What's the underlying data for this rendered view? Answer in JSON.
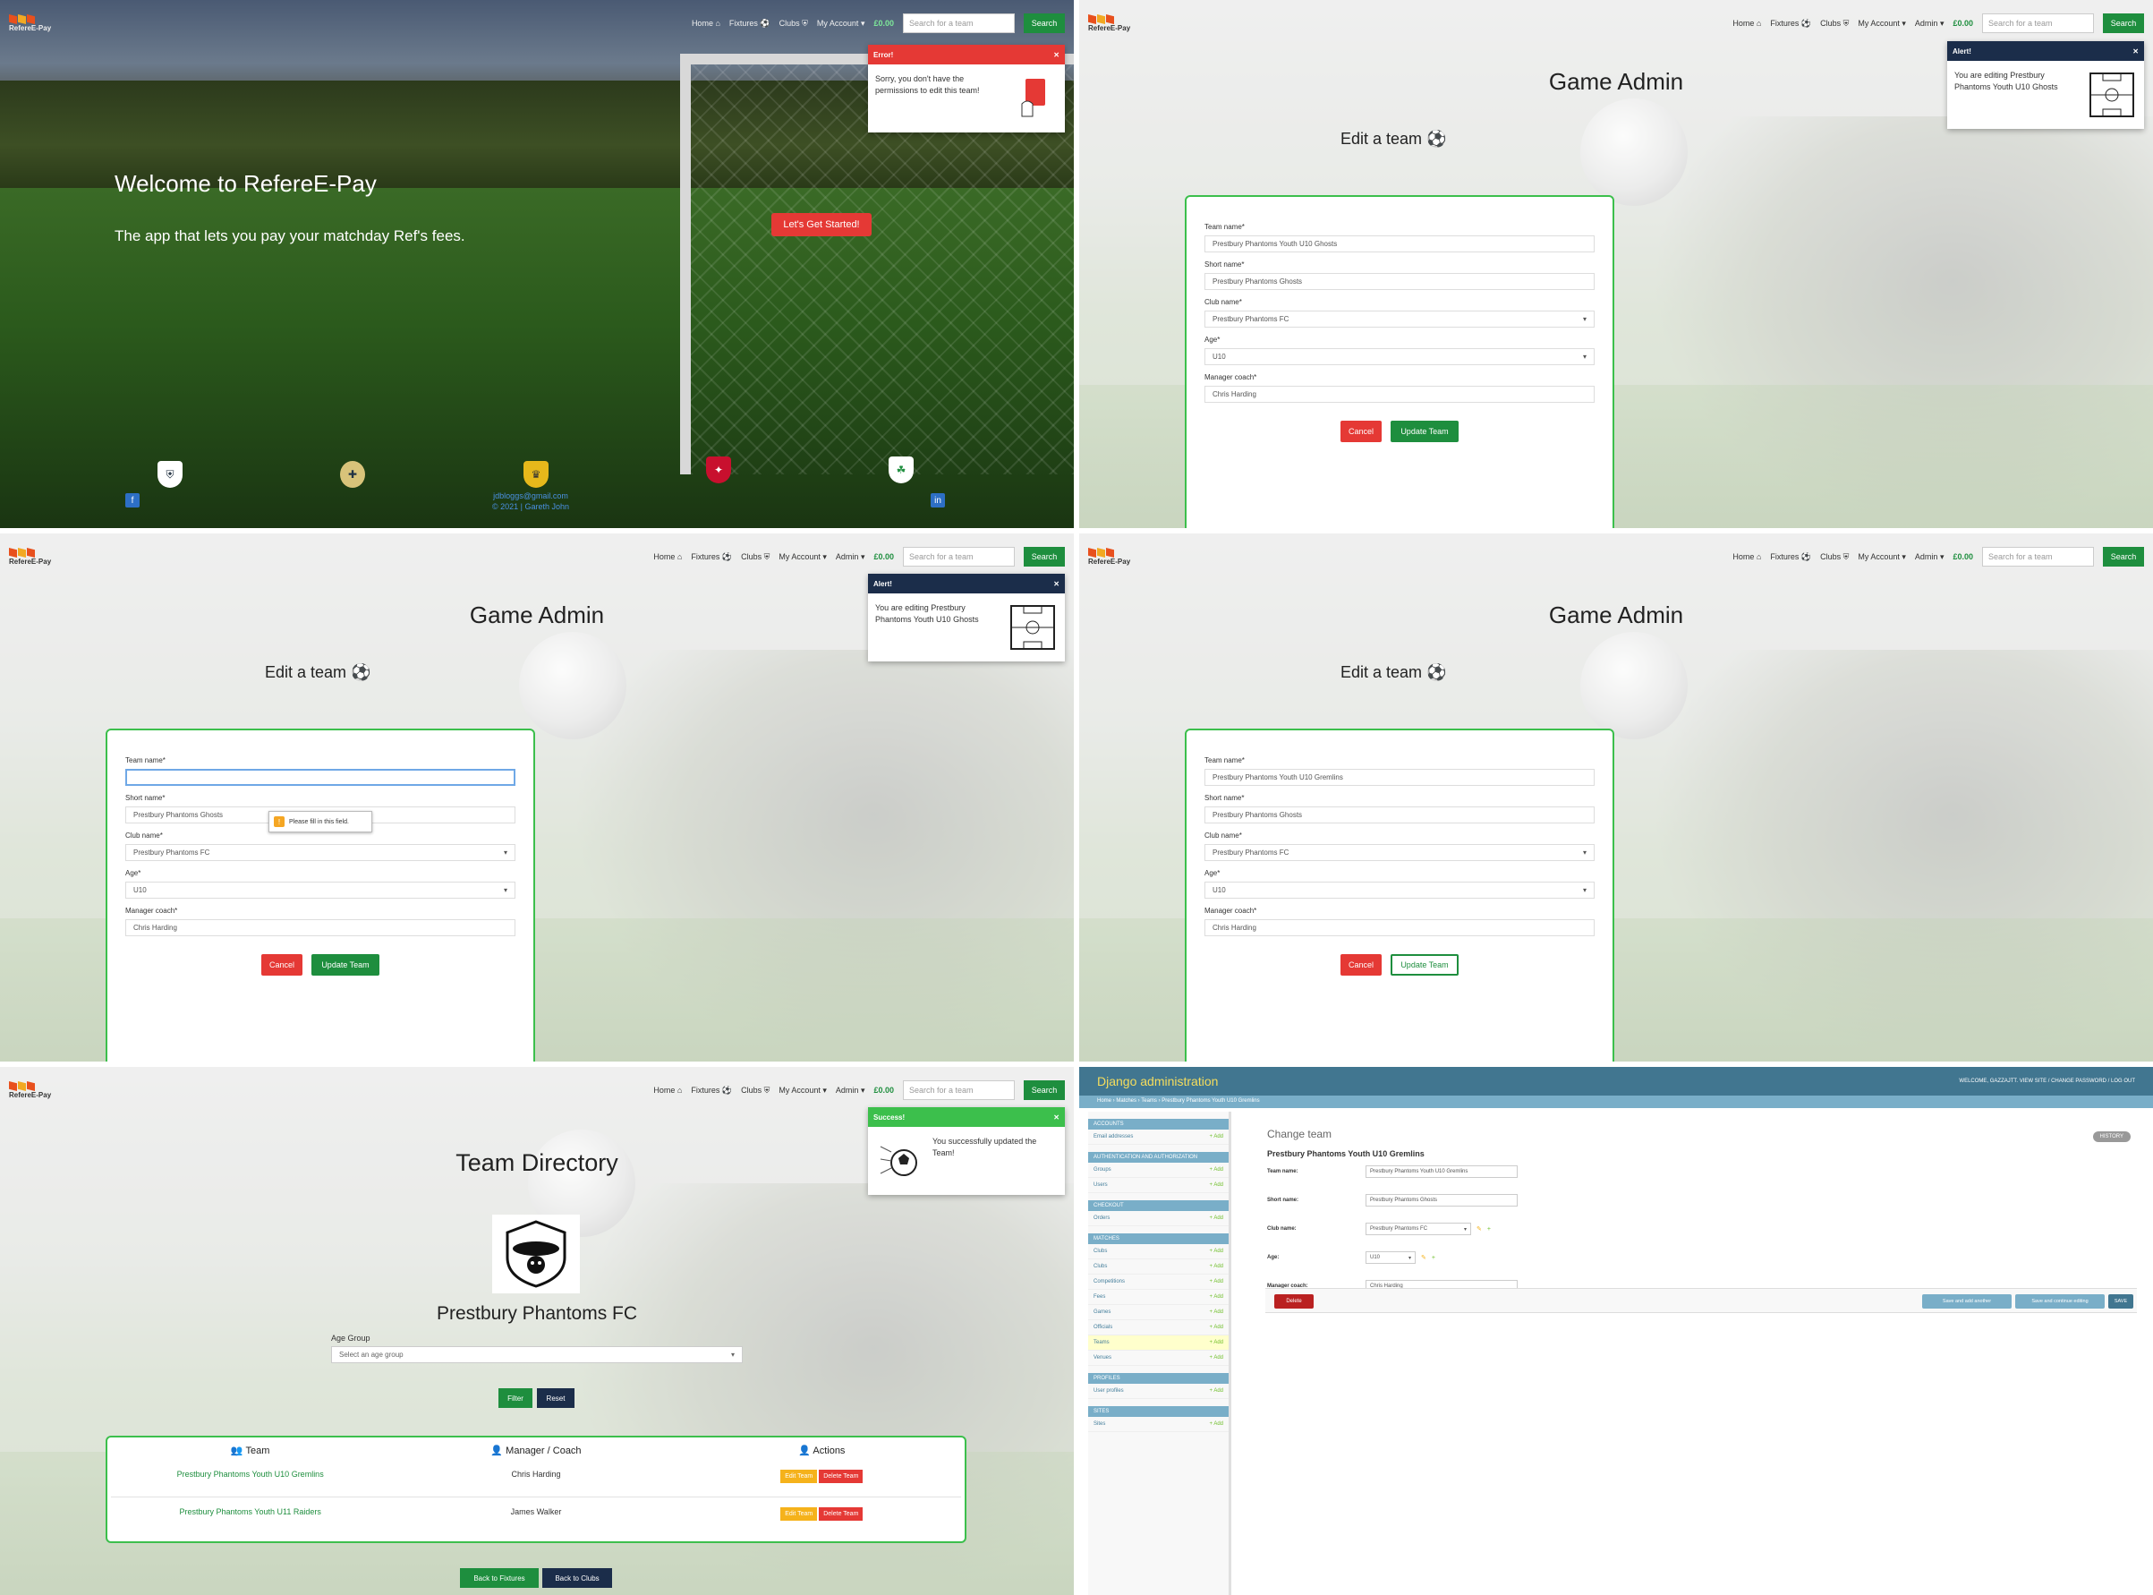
{
  "nav": {
    "brand": "RefereE-Pay",
    "home": "Home",
    "fixtures": "Fixtures",
    "clubs": "Clubs",
    "my_account": "My Account",
    "admin": "Admin",
    "wallet": "£0.00",
    "search_placeholder": "Search for a team",
    "search_button": "Search"
  },
  "home": {
    "title": "Welcome to RefereE-Pay",
    "subtitle": "The app that lets you pay your matchday Ref's fees.",
    "cta": "Let's Get Started!",
    "toast_header": "Error!",
    "toast_body": "Sorry, you don't have the permissions to edit this team!",
    "footer_email": "jdbloggs@gmail.com",
    "footer_copy": "© 2021 | Gareth John"
  },
  "game_admin": {
    "title": "Game Admin",
    "subtitle": "Edit a team",
    "toast_header": "Alert!",
    "toast_body": "You are editing Prestbury Phantoms Youth U10 Ghosts",
    "labels": {
      "team_name": "Team name*",
      "short_name": "Short name*",
      "club_name": "Club name*",
      "age": "Age*",
      "manager": "Manager coach*"
    },
    "values_p2": {
      "team_name": "Prestbury Phantoms Youth U10 Ghosts",
      "short_name": "Prestbury Phantoms Ghosts",
      "club_name": "Prestbury Phantoms FC",
      "age": "U10",
      "manager": "Chris Harding"
    },
    "values_p3": {
      "team_name": "",
      "short_name": "Prestbury Phantoms Ghosts",
      "club_name": "Prestbury Phantoms FC",
      "age": "U10",
      "manager": "Chris Harding"
    },
    "values_p4": {
      "team_name": "Prestbury Phantoms Youth U10 Gremlins",
      "short_name": "Prestbury Phantoms Ghosts",
      "club_name": "Prestbury Phantoms FC",
      "age": "U10",
      "manager": "Chris Harding"
    },
    "tooltip": "Please fill in this field.",
    "cancel": "Cancel",
    "update": "Update Team"
  },
  "directory": {
    "title": "Team Directory",
    "club": "Prestbury Phantoms FC",
    "age_group_label": "Age Group",
    "age_group_placeholder": "Select an age group",
    "filter": "Filter",
    "reset": "Reset",
    "col_team": "Team",
    "col_manager": "Manager / Coach",
    "col_actions": "Actions",
    "rows": [
      {
        "team": "Prestbury Phantoms Youth U10 Gremlins",
        "manager": "Chris Harding"
      },
      {
        "team": "Prestbury Phantoms Youth U11 Raiders",
        "manager": "James Walker"
      }
    ],
    "edit": "Edit Team",
    "delete": "Delete Team",
    "back_fixtures": "Back to Fixtures",
    "back_clubs": "Back to Clubs",
    "toast_header": "Success!",
    "toast_body": "You successfully updated the Team!"
  },
  "django": {
    "brand": "Django administration",
    "user_tools": "WELCOME, GAZZAJTT. VIEW SITE / CHANGE PASSWORD / LOG OUT",
    "breadcrumbs": "Home › Matches › Teams › Prestbury Phantoms Youth U10 Gremlins",
    "sections": [
      {
        "name": "ACCOUNTS",
        "items": [
          "Email addresses"
        ]
      },
      {
        "name": "AUTHENTICATION AND AUTHORIZATION",
        "items": [
          "Groups",
          "Users"
        ]
      },
      {
        "name": "CHECKOUT",
        "items": [
          "Orders"
        ]
      },
      {
        "name": "MATCHES",
        "items": [
          "Clubs",
          "Clubs",
          "Competitions",
          "Fees",
          "Games",
          "Officials",
          "Teams",
          "Venues"
        ]
      },
      {
        "name": "PROFILES",
        "items": [
          "User profiles"
        ]
      },
      {
        "name": "SITES",
        "items": [
          "Sites"
        ]
      }
    ],
    "add": "+ Add",
    "h1": "Change team",
    "h2": "Prestbury Phantoms Youth U10 Gremlins",
    "history": "HISTORY",
    "fields": {
      "team_name_label": "Team name:",
      "team_name": "Prestbury Phantoms Youth U10 Gremlins",
      "short_name_label": "Short name:",
      "short_name": "Prestbury Phantoms Ghosts",
      "club_name_label": "Club name:",
      "club_name": "Prestbury Phantoms FC",
      "age_label": "Age:",
      "age": "U10",
      "manager_label": "Manager coach:",
      "manager": "Chris Harding"
    },
    "delete": "Delete",
    "save_add": "Save and add another",
    "save_continue": "Save and continue editing",
    "save": "SAVE"
  }
}
